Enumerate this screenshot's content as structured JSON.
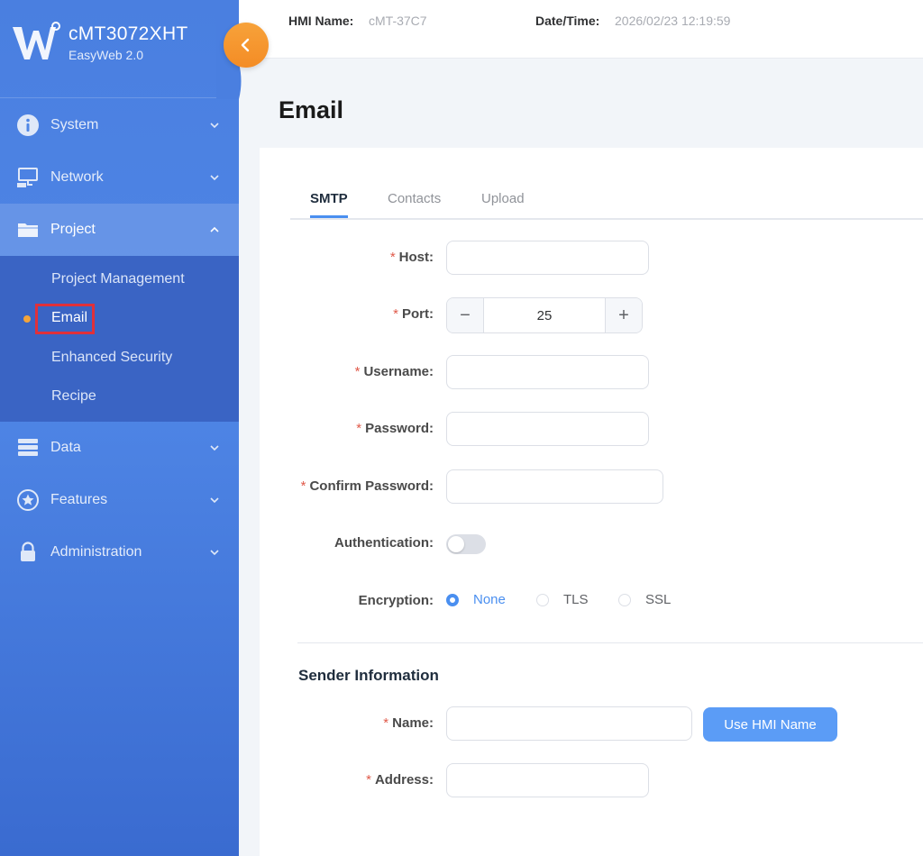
{
  "brand": {
    "title": "cMT3072XHT",
    "subtitle": "EasyWeb 2.0"
  },
  "header": {
    "hmi_label": "HMI Name:",
    "hmi_value": "cMT-37C7",
    "date_label": "Date/Time:",
    "date_value": "2026/02/23 12:19:59"
  },
  "sidebar": {
    "items": [
      {
        "label": "System",
        "icon": "info-icon"
      },
      {
        "label": "Network",
        "icon": "network-icon"
      },
      {
        "label": "Project",
        "icon": "folder-icon"
      },
      {
        "label": "Data",
        "icon": "database-icon"
      },
      {
        "label": "Features",
        "icon": "star-icon"
      },
      {
        "label": "Administration",
        "icon": "lock-icon"
      }
    ],
    "project_sub": [
      "Project Management",
      "Email",
      "Enhanced Security",
      "Recipe"
    ]
  },
  "page": {
    "title": "Email"
  },
  "tabs": [
    "SMTP",
    "Contacts",
    "Upload"
  ],
  "form": {
    "host_label": "Host:",
    "host_value": "",
    "port_label": "Port:",
    "port_value": "25",
    "username_label": "Username:",
    "username_value": "",
    "password_label": "Password:",
    "password_value": "",
    "confirm_label": "Confirm Password:",
    "confirm_value": "",
    "auth_label": "Authentication:",
    "auth_enabled": false,
    "encryption_label": "Encryption:",
    "encryption_options": [
      "None",
      "TLS",
      "SSL"
    ],
    "encryption_selected": "None"
  },
  "sender": {
    "title": "Sender Information",
    "name_label": "Name:",
    "name_value": "",
    "address_label": "Address:",
    "address_value": "",
    "use_hmi_button": "Use HMI Name"
  },
  "colors": {
    "accent": "#4a8ff0",
    "sidebar": "#4f86e6",
    "orange": "#f48c25",
    "required": "#e05a4a"
  }
}
